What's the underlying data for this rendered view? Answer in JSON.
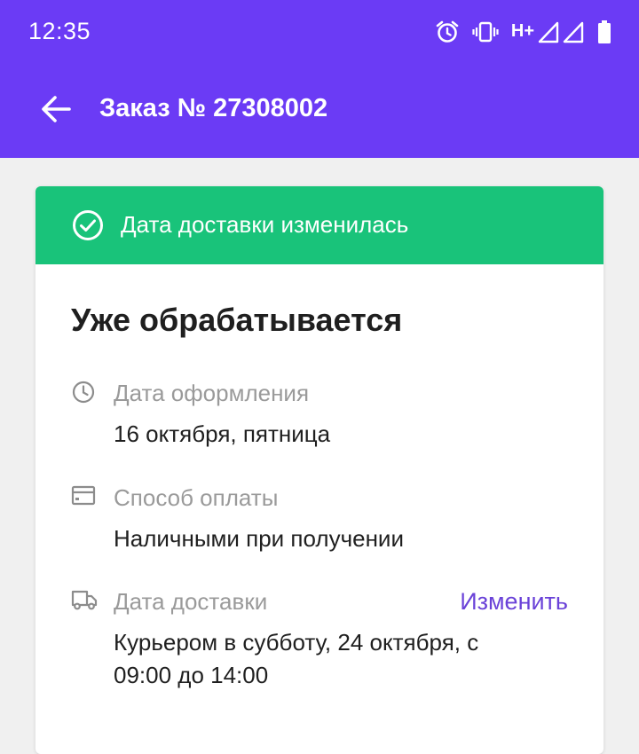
{
  "status_bar": {
    "time": "12:35",
    "icons": [
      "alarm-icon",
      "vibrate-icon",
      "network-hplus-icon",
      "signal-icon",
      "signal-icon",
      "battery-icon"
    ],
    "network_label": "H+"
  },
  "app_bar": {
    "back_icon": "arrow-left-icon",
    "title": "Заказ № 27308002",
    "background_color": "#6b3bf5"
  },
  "banner": {
    "icon": "check-circle-icon",
    "text": "Дата доставки изменилась",
    "background_color": "#19c37a"
  },
  "order": {
    "status": "Уже обрабатывается",
    "details": [
      {
        "icon": "clock-icon",
        "label": "Дата оформления",
        "value": "16 октября, пятница"
      },
      {
        "icon": "card-icon",
        "label": "Способ оплаты",
        "value": "Наличными при получении"
      },
      {
        "icon": "truck-icon",
        "label": "Дата доставки",
        "value": "Курьером в субботу, 24 октября, с 09:00 до 14:00",
        "action": "Изменить"
      }
    ]
  },
  "colors": {
    "accent": "#6a42d8",
    "label_gray": "#9a9a9a",
    "text_dark": "#1f1f1f"
  }
}
